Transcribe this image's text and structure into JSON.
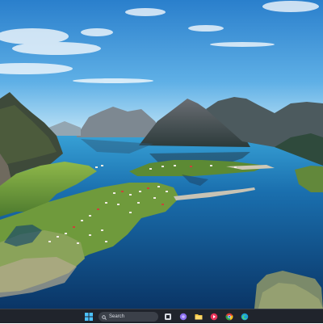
{
  "taskbar": {
    "search_placeholder": "Search",
    "pinned_icons": [
      "windows-start-icon",
      "task-view-icon",
      "widgets-icon",
      "file-explorer-icon",
      "media-player-icon",
      "chrome-icon",
      "edge-icon"
    ]
  },
  "colors": {
    "sky_top": "#2f86d3",
    "sky_horizon": "#b9e0f6",
    "water_deep": "#0b3e72",
    "water_shallow": "#1f7fb8",
    "taskbar": "#20242c",
    "windows_blue": "#4cc2ff"
  }
}
